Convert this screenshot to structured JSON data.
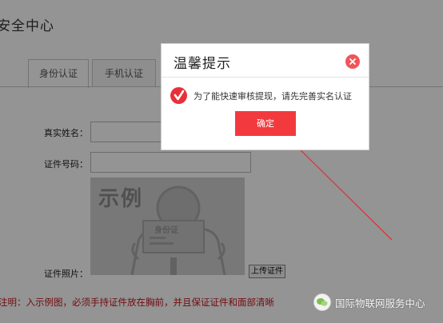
{
  "page": {
    "title": "安全中心",
    "tabs": [
      {
        "label": "身份认证",
        "active": true
      },
      {
        "label": "手机认证",
        "active": false
      }
    ]
  },
  "form": {
    "name_label": "真实姓名：",
    "name_value": "",
    "id_label": "证件号码：",
    "id_value": "",
    "photo_label": "证件照片：",
    "sample_word": "示例",
    "sample_card_text": "身份证",
    "upload_label": "上传证件"
  },
  "note": "注明：入示例图，必须手持证件放在胸前，并且保证证件和面部清晰",
  "dialog": {
    "title": "温馨提示",
    "message": "为了能快速审核提现，请先完善实名认证",
    "ok_label": "确定"
  },
  "watermark": {
    "text": "国际物联网服务中心"
  },
  "colors": {
    "accent_red": "#f23a3e",
    "note_red": "#c8161d",
    "overlay": "rgba(0,0,0,0.42)"
  },
  "icons": {
    "close": "close-icon",
    "check": "check-icon",
    "logo": "wechat-logo-icon"
  }
}
